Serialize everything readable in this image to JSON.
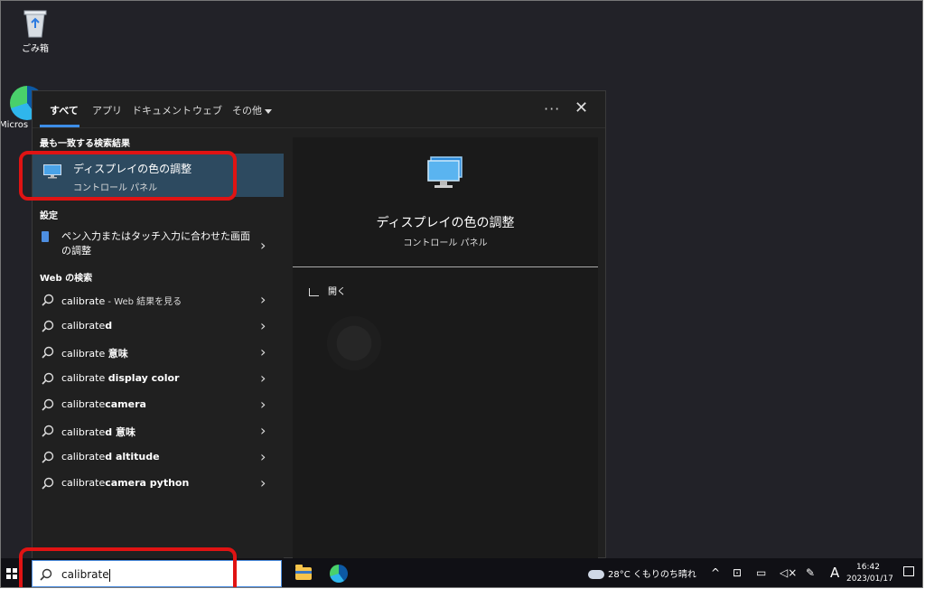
{
  "desktop": {
    "recycle_bin_label": "ごみ箱",
    "edge_label": "Micros"
  },
  "tabs": [
    {
      "label": "すべて",
      "active": true
    },
    {
      "label": "アプリ"
    },
    {
      "label": "ドキュメント"
    },
    {
      "label": "ウェブ"
    },
    {
      "label": "その他"
    }
  ],
  "header": {
    "more_glyph": "···",
    "close_glyph": "✕"
  },
  "best_match": {
    "section": "最も一致する検索結果",
    "title": "ディスプレイの色の調整",
    "subtitle": "コントロール パネル",
    "icon": "monitor-icon"
  },
  "settings": {
    "section": "設定",
    "item": "ペン入力またはタッチ入力に合わせた画面の調整",
    "icon": "tablet-icon"
  },
  "web": {
    "section": "Web の検索",
    "items": [
      {
        "normal": "calibrate",
        "bold": "",
        "small": " - Web 結果を見る"
      },
      {
        "normal": "calibrate",
        "bold": "d",
        "small": ""
      },
      {
        "normal": "calibrate ",
        "bold": "意味",
        "small": ""
      },
      {
        "normal": "calibrate ",
        "bold": "display color",
        "small": ""
      },
      {
        "normal": "calibrate",
        "bold": "camera",
        "small": ""
      },
      {
        "normal": "calibrate",
        "bold": "d 意味",
        "small": ""
      },
      {
        "normal": "calibrate",
        "bold": "d altitude",
        "small": ""
      },
      {
        "normal": "calibrate",
        "bold": "camera python",
        "small": ""
      }
    ]
  },
  "preview": {
    "title": "ディスプレイの色の調整",
    "subtitle": "コントロール パネル",
    "open_action": "開く"
  },
  "taskbar": {
    "search_value": "calibrate",
    "weather_temp": "28°C",
    "weather_desc": "くもりのち晴れ",
    "tray_chevron": "^",
    "ime": "A",
    "time": "16:42",
    "date": "2023/01/17"
  },
  "colors": {
    "accent": "#3d8ee8",
    "highlight": "#2d4a60",
    "annotation": "#e01313"
  }
}
